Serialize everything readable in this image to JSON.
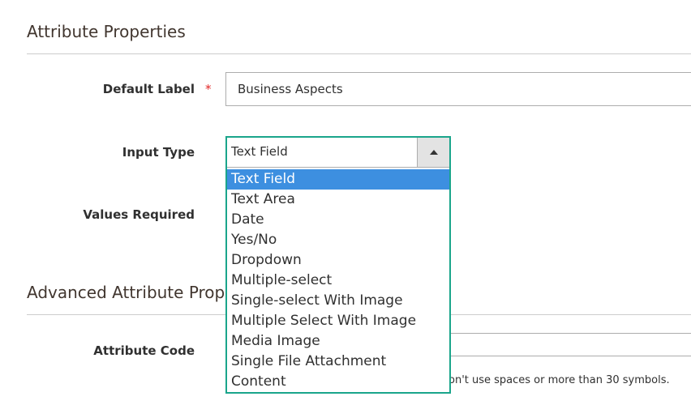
{
  "sections": {
    "attribute_properties_title": "Attribute Properties",
    "advanced_title": "Advanced Attribute Prop"
  },
  "fields": {
    "default_label": {
      "label": "Default Label",
      "required_mark": "*",
      "value": "Business Aspects"
    },
    "input_type": {
      "label": "Input Type",
      "selected": "Text Field",
      "options": [
        "Text Field",
        "Text Area",
        "Date",
        "Yes/No",
        "Dropdown",
        "Multiple-select",
        "Single-select With Image",
        "Multiple Select With Image",
        "Media Image",
        "Single File Attachment",
        "Content"
      ]
    },
    "values_required": {
      "label": "Values Required"
    },
    "attribute_code": {
      "label": "Attribute Code",
      "note_visible": "on't use spaces or more than 30 symbols."
    }
  },
  "colors": {
    "focus_border": "#1aa58b",
    "option_highlight": "#3d8fe0",
    "required_star": "#e22626"
  },
  "icons": {
    "select_arrow": "triangle-up-icon"
  }
}
